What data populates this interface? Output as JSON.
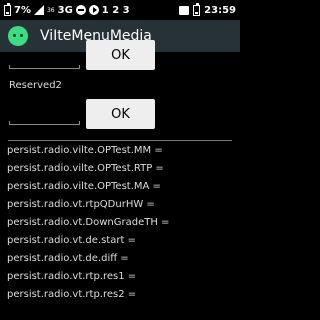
{
  "status_bar": {
    "battery_percent": "7%",
    "network_super": "36",
    "network": "3G",
    "sim_indicators": "1 2 3",
    "time": "23:59"
  },
  "app_bar": {
    "title": "ViIteMenuMedia",
    "icon": "android-icon"
  },
  "form": {
    "top_button_label": "OK",
    "reserved_label": "Reserved2",
    "reserved_button_label": "OK"
  },
  "properties": [
    "persist.radio.vilte.OPTest.MM =",
    "persist.radio.vilte.OPTest.RTP =",
    "persist.radio.vilte.OPTest.MA =",
    "persist.radio.vt.rtpQDurHW =",
    "persist.radio.vt.DownGradeTH =",
    "persist.radio.vt.de.start =",
    "persist.radio.vt.de.diff =",
    "persist.radio.vt.rtp.res1 =",
    "persist.radio.vt.rtp.res2 ="
  ],
  "colors": {
    "app_bar": "#263238",
    "background": "#000000",
    "button": "#eeeeee"
  }
}
